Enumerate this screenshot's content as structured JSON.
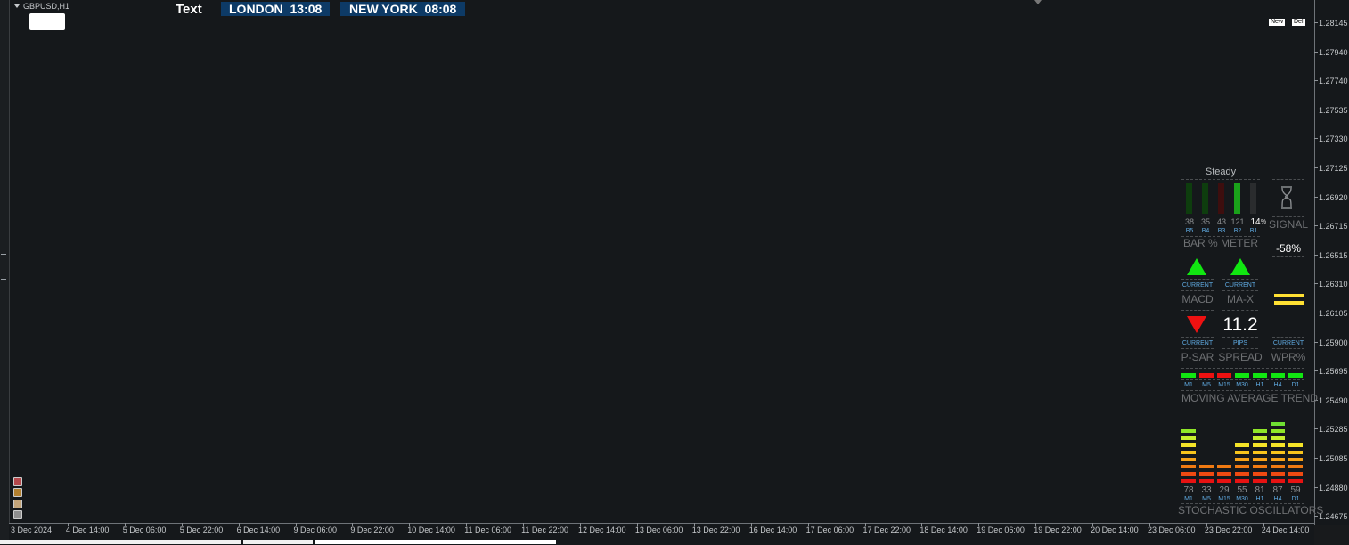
{
  "chart_header": {
    "symbol": "GBPUSD,H1",
    "text_label": "Text",
    "clocks": [
      {
        "city": "LONDON",
        "time": "13:08"
      },
      {
        "city": "NEW YORK",
        "time": "08:08"
      }
    ],
    "buttons": [
      "New",
      "Del"
    ]
  },
  "y_axis": {
    "labels": [
      "1.28145",
      "1.27940",
      "1.27740",
      "1.27535",
      "1.27330",
      "1.27125",
      "1.26920",
      "1.26715",
      "1.26515",
      "1.26310",
      "1.26105",
      "1.25900",
      "1.25695",
      "1.25490",
      "1.25285",
      "1.25085",
      "1.24880",
      "1.24675"
    ]
  },
  "x_axis": {
    "labels": [
      "3 Dec 2024",
      "4 Dec 14:00",
      "5 Dec 06:00",
      "5 Dec 22:00",
      "6 Dec 14:00",
      "9 Dec 06:00",
      "9 Dec 22:00",
      "10 Dec 14:00",
      "11 Dec 06:00",
      "11 Dec 22:00",
      "12 Dec 14:00",
      "13 Dec 06:00",
      "13 Dec 22:00",
      "16 Dec 14:00",
      "17 Dec 06:00",
      "17 Dec 22:00",
      "18 Dec 14:00",
      "19 Dec 06:00",
      "19 Dec 22:00",
      "20 Dec 14:00",
      "23 Dec 06:00",
      "23 Dec 22:00",
      "24 Dec 14:00"
    ]
  },
  "panel": {
    "state": "Steady",
    "bar_meter": {
      "title": "BAR % METER",
      "values": [
        "38",
        "35",
        "43",
        "121",
        "14"
      ],
      "labels": [
        "B5",
        "B4",
        "B3",
        "B2",
        "B1"
      ],
      "percent_sign": "%",
      "colors": [
        "#0e3d0e",
        "#0e3d0e",
        "#3d0e0e",
        "#1aa11a",
        "#2a2c2e"
      ]
    },
    "signal": {
      "title": "SIGNAL",
      "value": "-58%",
      "icon": "hourglass-icon"
    },
    "macd": {
      "title": "MACD",
      "label": "CURRENT",
      "direction": "up"
    },
    "max": {
      "title": "MA-X",
      "label": "CURRENT",
      "direction": "up"
    },
    "psar": {
      "title": "P-SAR",
      "label": "CURRENT",
      "direction": "down"
    },
    "spread": {
      "title": "SPREAD",
      "label": "PIPS",
      "value": "11.2"
    },
    "wpr": {
      "title": "WPR%",
      "label": "CURRENT"
    },
    "ma_trend": {
      "title": "MOVING AVERAGE TREND",
      "timeframes": [
        "M1",
        "M5",
        "M15",
        "M30",
        "H1",
        "H4",
        "D1"
      ],
      "colors": [
        "#11e611",
        "#ee1111",
        "#ee1111",
        "#11e611",
        "#11e611",
        "#11e611",
        "#11e611"
      ]
    },
    "stochastic": {
      "title": "STOCHASTIC OSCILLATORS",
      "timeframes": [
        "M1",
        "M5",
        "M15",
        "M30",
        "H1",
        "H4",
        "D1"
      ],
      "values": [
        "78",
        "33",
        "29",
        "55",
        "81",
        "87",
        "59"
      ],
      "levels": [
        78,
        33,
        29,
        55,
        81,
        87,
        59
      ]
    }
  }
}
